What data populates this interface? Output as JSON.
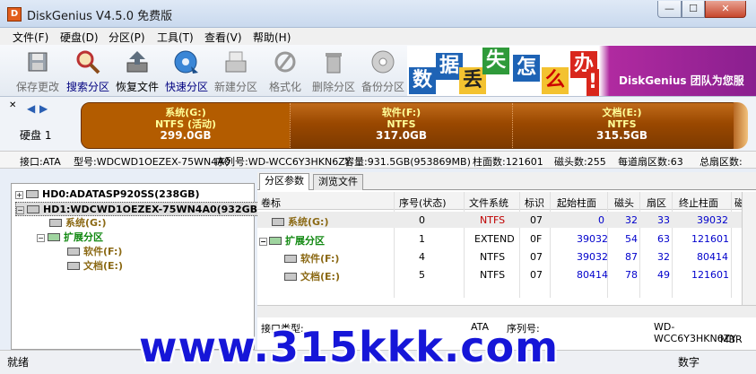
{
  "window": {
    "title": "DiskGenius V4.5.0 免费版",
    "min": "—",
    "max": "☐",
    "close": "✕"
  },
  "menu": [
    "文件(F)",
    "硬盘(D)",
    "分区(P)",
    "工具(T)",
    "查看(V)",
    "帮助(H)"
  ],
  "toolbar": [
    {
      "label": "保存更改",
      "icon": "save-icon",
      "state": "dim"
    },
    {
      "label": "搜索分区",
      "icon": "magnifier-icon",
      "state": "on"
    },
    {
      "label": "恢复文件",
      "icon": "recover-icon",
      "state": "normal"
    },
    {
      "label": "快速分区",
      "icon": "quick-partition-icon",
      "state": "on"
    },
    {
      "label": "新建分区",
      "icon": "new-partition-icon",
      "state": "dim"
    },
    {
      "label": "格式化",
      "icon": "format-icon",
      "state": "dim"
    },
    {
      "label": "删除分区",
      "icon": "delete-icon",
      "state": "dim"
    },
    {
      "label": "备份分区",
      "icon": "backup-icon",
      "state": "dim"
    }
  ],
  "banner": {
    "chars": [
      "数",
      "据",
      "丢",
      "失",
      "怎",
      "么",
      "办",
      "!"
    ],
    "text": "DiskGenius 团队为您服"
  },
  "disk_bar": {
    "label": "硬盘 1",
    "partitions": [
      {
        "name": "系统(G:)",
        "fs": "NTFS (活动)",
        "size": "299.0GB"
      },
      {
        "name": "软件(F:)",
        "fs": "NTFS",
        "size": "317.0GB"
      },
      {
        "name": "文档(E:)",
        "fs": "NTFS",
        "size": "315.5GB"
      }
    ]
  },
  "infoline": [
    "接口:ATA",
    "型号:WDCWD1OEZEX-75WN4A0",
    "序列号:WD-WCC6Y3HKN6ZY",
    "容量:931.5GB(953869MB)",
    "柱面数:121601",
    "磁头数:255",
    "每道扇区数:63",
    "总扇区数:"
  ],
  "tree": [
    {
      "text": "HD0:ADATASP920SS(238GB)",
      "style": "darkb",
      "box": "+"
    },
    {
      "text": "HD1:WDCWD1OEZEX-75WN4A0(932GB)",
      "style": "darkb",
      "box": "−"
    },
    {
      "text": "系统(G:)",
      "style": "olive"
    },
    {
      "text": "扩展分区",
      "style": "green",
      "box": "−"
    },
    {
      "text": "软件(F:)",
      "style": "olive"
    },
    {
      "text": "文档(E:)",
      "style": "olive"
    }
  ],
  "tabs": [
    "分区参数",
    "浏览文件"
  ],
  "table": {
    "headers": [
      "卷标",
      "序号(状态)",
      "文件系统",
      "标识",
      "起始柱面",
      "磁头",
      "扇区",
      "终止柱面",
      "磁"
    ],
    "rows": [
      [
        "系统(G:)",
        "0",
        "NTFS",
        "07",
        "0",
        "32",
        "33",
        "39032"
      ],
      [
        "扩展分区",
        "1",
        "EXTEND",
        "0F",
        "39032",
        "54",
        "63",
        "121601"
      ],
      [
        "软件(F:)",
        "4",
        "NTFS",
        "07",
        "39032",
        "87",
        "32",
        "80414"
      ],
      [
        "文档(E:)",
        "5",
        "NTFS",
        "07",
        "80414",
        "78",
        "49",
        "121601"
      ]
    ]
  },
  "detail": {
    "iface_label": "接口类型:",
    "iface_value": "ATA",
    "serial_label": "序列号:",
    "serial_value": "WD-WCC6Y3HKN6ZY",
    "tail": "MBR"
  },
  "status": {
    "left": "就绪",
    "right": "数字"
  },
  "watermark": "www.315kkk.com"
}
